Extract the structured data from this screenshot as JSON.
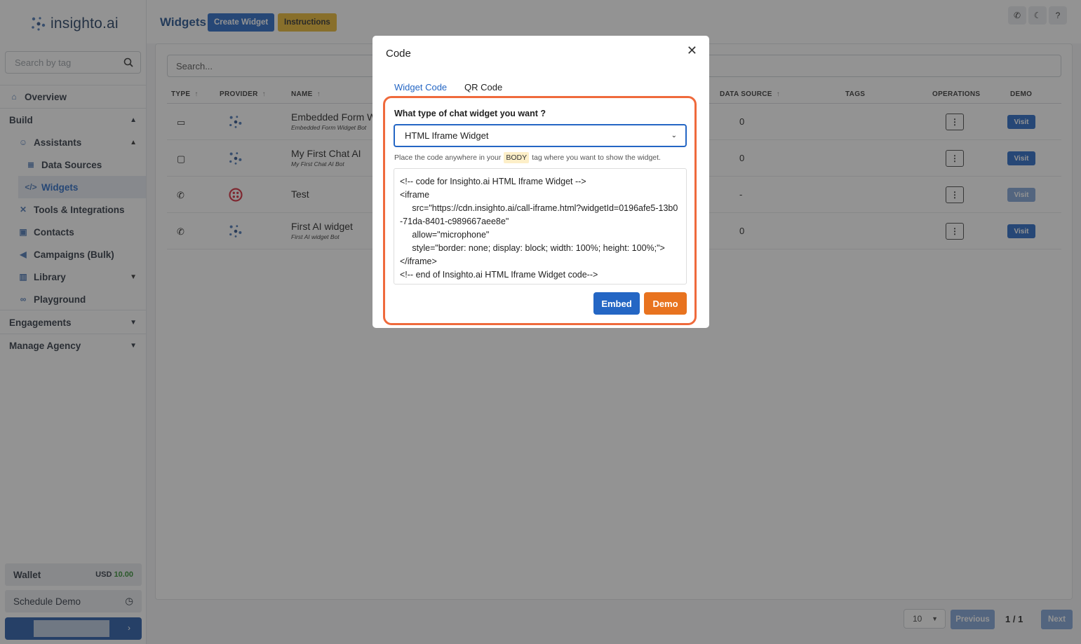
{
  "app": {
    "logo_text": "insighto.ai"
  },
  "sidebar": {
    "search_placeholder": "Search by tag",
    "items": [
      {
        "label": "Overview",
        "icon": "home-icon"
      },
      {
        "label": "Build",
        "icon": "chevron-up-icon"
      },
      {
        "label": "Assistants",
        "icon": "user-icon"
      },
      {
        "label": "Data Sources",
        "icon": "database-icon"
      },
      {
        "label": "Widgets",
        "icon": "code-icon"
      },
      {
        "label": "Tools & Integrations",
        "icon": "tools-icon"
      },
      {
        "label": "Contacts",
        "icon": "contacts-icon"
      },
      {
        "label": "Campaigns (Bulk)",
        "icon": "megaphone-icon"
      },
      {
        "label": "Library",
        "icon": "library-icon"
      },
      {
        "label": "Playground",
        "icon": "gamepad-icon"
      },
      {
        "label": "Engagements",
        "icon": "chevron-down-icon"
      },
      {
        "label": "Manage Agency",
        "icon": "chevron-down-icon"
      }
    ],
    "wallet": {
      "label": "Wallet",
      "currency": "USD",
      "amount": "10.00"
    },
    "schedule_demo": "Schedule Demo"
  },
  "header": {
    "title": "Widgets",
    "create_label": "Create Widget",
    "instructions_label": "Instructions",
    "icons": [
      "phone-icon",
      "moon-icon",
      "help-icon"
    ]
  },
  "table": {
    "search_placeholder": "Search...",
    "columns": [
      "TYPE",
      "PROVIDER",
      "NAME",
      "DATA SOURCE",
      "TAGS",
      "OPERATIONS",
      "DEMO"
    ],
    "rows": [
      {
        "type_icon": "window-icon",
        "provider_icon": "insighto-logo-icon",
        "name": "Embedded Form W",
        "subtitle": "Embedded Form Widget Bot",
        "data_source": "0",
        "demo": "Visit"
      },
      {
        "type_icon": "chat-icon",
        "provider_icon": "insighto-logo-icon",
        "name": "My First Chat AI",
        "subtitle": "My First Chat AI Bot",
        "data_source": "0",
        "demo": "Visit"
      },
      {
        "type_icon": "phone-icon",
        "provider_icon": "twilio-icon",
        "name": "Test",
        "subtitle": "",
        "data_source": "-",
        "demo": "Visit"
      },
      {
        "type_icon": "phone-call-icon",
        "provider_icon": "insighto-logo-icon",
        "name": "First AI widget",
        "subtitle": "First AI widget Bot",
        "data_source": "0",
        "demo": "Visit"
      }
    ]
  },
  "pagination": {
    "page_size": "10",
    "previous": "Previous",
    "next": "Next",
    "page_info": "1 / 1"
  },
  "modal": {
    "title": "Code",
    "tabs": [
      "Widget Code",
      "QR Code"
    ],
    "question": "What type of chat widget you want ?",
    "selected_type": "HTML Iframe Widget",
    "hint_before": "Place the code anywhere in your",
    "hint_tag": "BODY",
    "hint_after": "tag where you want to show the widget.",
    "code": "<!-- code for Insighto.ai HTML Iframe Widget -->\n<iframe\n     src=\"https://cdn.insighto.ai/call-iframe.html?widgetId=0196afe5-13b0-71da-8401-c989667aee8e\"\n     allow=\"microphone\"\n     style=\"border: none; display: block; width: 100%; height: 100%;\">\n</iframe>\n<!-- end of Insighto.ai HTML Iframe Widget code-->",
    "embed_label": "Embed",
    "demo_label": "Demo"
  },
  "colors": {
    "primary": "#2466c4",
    "accent": "#e8731f",
    "highlight": "#ef6a3c",
    "instructions": "#e9b72e"
  }
}
